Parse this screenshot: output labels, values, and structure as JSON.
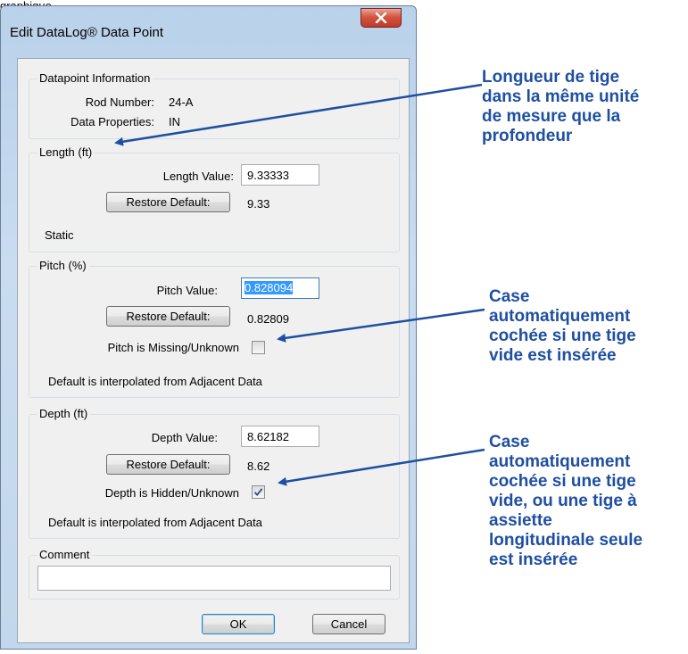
{
  "caption": "graphique",
  "window": {
    "title": "Edit DataLog® Data Point"
  },
  "datapoint": {
    "legend": "Datapoint Information",
    "rod_number_label": "Rod Number:",
    "rod_number_value": "24-A",
    "data_properties_label": "Data Properties:",
    "data_properties_value": "IN"
  },
  "length": {
    "legend": "Length (ft)",
    "value_label": "Length Value:",
    "value": "9.33333",
    "restore_label": "Restore Default:",
    "default_value": "9.33",
    "status_text": "Static"
  },
  "pitch": {
    "legend": "Pitch (%)",
    "value_label": "Pitch Value:",
    "value": "0.828094",
    "restore_label": "Restore Default:",
    "default_value": "0.82809",
    "missing_label": "Pitch is Missing/Unknown",
    "missing_checked": false,
    "note": "Default is interpolated from Adjacent Data"
  },
  "depth": {
    "legend": "Depth (ft)",
    "value_label": "Depth Value:",
    "value": "8.62182",
    "restore_label": "Restore Default:",
    "default_value": "8.62",
    "hidden_label": "Depth is Hidden/Unknown",
    "hidden_checked": true,
    "note": "Default is interpolated from Adjacent Data"
  },
  "comment": {
    "legend": "Comment",
    "value": ""
  },
  "buttons": {
    "ok_label": "OK",
    "cancel_label": "Cancel"
  },
  "annotations": {
    "length_note": [
      "Longueur de tige",
      "dans la même unité",
      "de mesure que la",
      "profondeur"
    ],
    "pitch_note": [
      "Case",
      "automatiquement",
      "cochée si une tige",
      "vide est insérée"
    ],
    "depth_note": [
      "Case",
      "automatiquement",
      "cochée si une tige",
      "vide, ou une tige à",
      "assiette",
      "longitudinale seule",
      "est insérée"
    ]
  },
  "colors": {
    "annotation": "#1f4fa1",
    "selection": "#3399ff",
    "close_button": "#c0392b"
  }
}
